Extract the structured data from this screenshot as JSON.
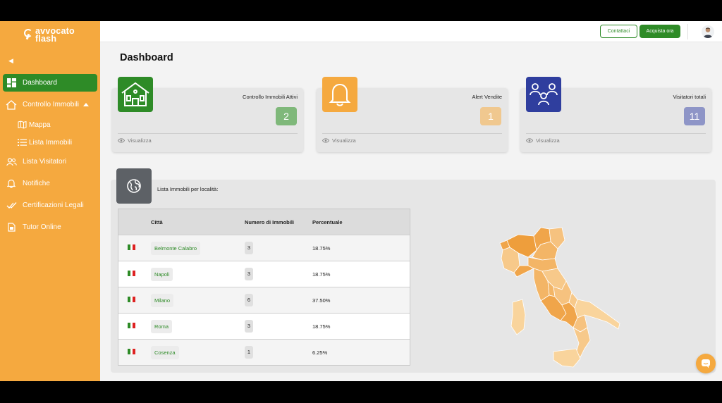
{
  "brand": {
    "line1": "avvocato",
    "line2": "flash"
  },
  "sidebar": {
    "items": [
      {
        "label": "Dashboard",
        "icon": "dashboard-icon",
        "active": true
      },
      {
        "label": "Controllo Immobili",
        "icon": "home-icon",
        "expanded": true
      },
      {
        "label": "Mappa",
        "icon": "map-icon",
        "sub": true
      },
      {
        "label": "Lista Immobili",
        "icon": "list-icon",
        "sub": true
      },
      {
        "label": "Lista Visitatori",
        "icon": "users-icon"
      },
      {
        "label": "Notifiche",
        "icon": "bell-icon"
      },
      {
        "label": "Certificazioni Legali",
        "icon": "checkmark-icon"
      },
      {
        "label": "Tutor Online",
        "icon": "document-icon"
      }
    ]
  },
  "header": {
    "contact_label": "Contattaci",
    "buy_label": "Acquista ora"
  },
  "page": {
    "title": "Dashboard"
  },
  "cards": [
    {
      "label": "Controllo Immobili Attivi",
      "value": "2",
      "link": "Visualizza",
      "tile_color": "#2e8b27",
      "badge_color": "#7fb87a",
      "icon": "house-icon"
    },
    {
      "label": "Alert Vendite",
      "value": "1",
      "link": "Visualizza",
      "tile_color": "#f5a93f",
      "badge_color": "#f0c88f",
      "icon": "bell-icon"
    },
    {
      "label": "Visitatori totali",
      "value": "11",
      "link": "Visualizza",
      "tile_color": "#2f3e9e",
      "badge_color": "#8e95c7",
      "icon": "people-icon"
    }
  ],
  "locations": {
    "title": "Lista Immobili per località:",
    "icon": "globe-icon",
    "columns": {
      "flag": "",
      "city": "Città",
      "count": "Numero di Immobili",
      "percent": "Percentuale"
    },
    "rows": [
      {
        "city": "Belmonte Calabro",
        "count": "3",
        "percent": "18.75%"
      },
      {
        "city": "Napoli",
        "count": "3",
        "percent": "18.75%"
      },
      {
        "city": "Milano",
        "count": "6",
        "percent": "37.50%"
      },
      {
        "city": "Roma",
        "count": "3",
        "percent": "18.75%"
      },
      {
        "city": "Cosenza",
        "count": "1",
        "percent": "6.25%"
      }
    ]
  },
  "colors": {
    "accent": "#f5a93f",
    "primary": "#2e8b27"
  }
}
